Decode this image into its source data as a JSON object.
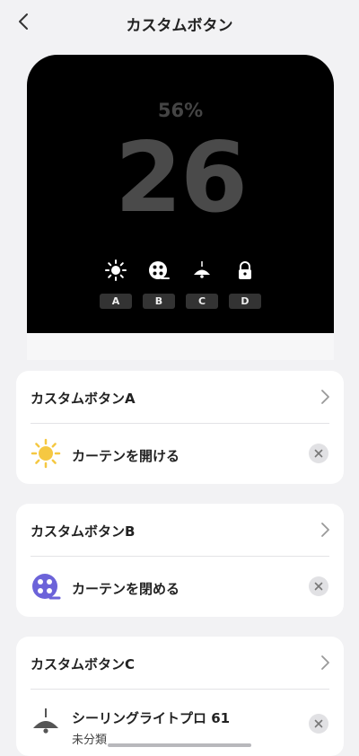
{
  "header": {
    "title": "カスタムボタン"
  },
  "device": {
    "battery": "56%",
    "number": "26",
    "icons": [
      "sun-icon",
      "reel-icon",
      "ceiling-light-icon",
      "lock-icon"
    ],
    "keys": [
      "A",
      "B",
      "C",
      "D"
    ]
  },
  "cards": [
    {
      "title": "カスタムボタンA",
      "action_label": "カーテンを開ける",
      "icon": "sun-icon"
    },
    {
      "title": "カスタムボタンB",
      "action_label": "カーテンを閉める",
      "icon": "reel-icon"
    },
    {
      "title": "カスタムボタンC",
      "action_label": "シーリングライトプロ 61",
      "action_sub": "未分類",
      "icon": "ceiling-light-icon"
    }
  ],
  "colors": {
    "background": "#f2f2f4",
    "device": "#000000",
    "sun": "#f5c842",
    "reel": "#6c63d9"
  }
}
